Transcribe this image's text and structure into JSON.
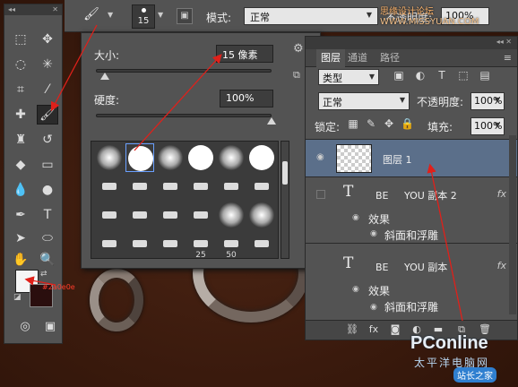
{
  "options_bar": {
    "brush_size": "15",
    "mode_label": "模式:",
    "mode_value": "正常",
    "opacity_label": "不透明度:",
    "opacity_value": "100%",
    "watermark": "思缘设计论坛",
    "watermark_site": "WWW.MISSYUAN.COM"
  },
  "toolbox": {
    "header": "◂◂",
    "tools": [
      "marquee",
      "move",
      "lasso",
      "magic-wand",
      "crop",
      "eyedropper",
      "healing",
      "brush",
      "stamp",
      "history-brush",
      "eraser",
      "gradient",
      "blur",
      "dodge",
      "pen",
      "type",
      "path-select",
      "ellipse",
      "hand",
      "zoom"
    ],
    "foreground_color": "#f5f5f5",
    "background_color": "#2a0e0e",
    "color_label": "#2a0e0e"
  },
  "brush_panel": {
    "size_label": "大小:",
    "size_value": "15 像素",
    "hardness_label": "硬度:",
    "hardness_value": "100%",
    "size_slider": 0.05,
    "hardness_slider": 1.0,
    "preset_numbers": [
      "25",
      "50"
    ]
  },
  "layers_panel": {
    "tabs": [
      "图层",
      "通道",
      "路径"
    ],
    "filter_kind": "类型",
    "blend_mode": "正常",
    "opacity_label": "不透明度:",
    "opacity_value": "100%",
    "lock_label": "锁定:",
    "fill_label": "填充:",
    "fill_value": "100%",
    "layers": [
      {
        "name": "图层 1",
        "selected": true
      },
      {
        "name": "BE     YOU 副本 2",
        "effects_label": "效果",
        "effect": "斜面和浮雕"
      },
      {
        "name": "BE     YOU 副本",
        "effects_label": "效果",
        "effect": "斜面和浮雕"
      }
    ],
    "fx": "fx"
  },
  "watermark_bottom": {
    "brand": "PConline",
    "cn": "太平洋电脑网",
    "tag": "站长之家"
  }
}
